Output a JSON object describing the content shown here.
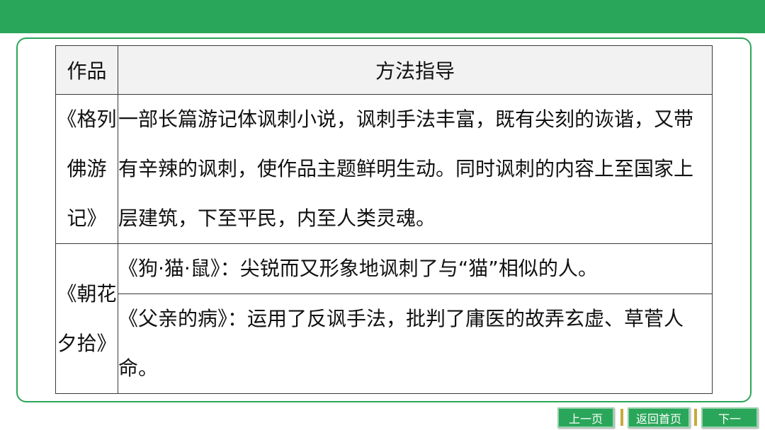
{
  "colors": {
    "accent": "#2aa65a",
    "separator": "#c8a93a"
  },
  "table": {
    "headers": {
      "work": "作品",
      "method": "方法指导"
    },
    "rows": [
      {
        "work": "《格列佛游记》",
        "method": "一部长篇游记体讽刺小说，讽刺手法丰富，既有尖刻的诙谐，又带有辛辣的讽刺，使作品主题鲜明生动。同时讽刺的内容上至国家上层建筑，下至平民，内至人类灵魂。"
      },
      {
        "work": "《朝花夕拾》",
        "methods": [
          "《狗·猫·鼠》：尖锐而又形象地讽刺了与“猫”相似的人。",
          "《父亲的病》：运用了反讽手法，批判了庸医的故弄玄虚、草菅人命。"
        ]
      }
    ]
  },
  "nav": {
    "prev": "上一页",
    "home": "返回首页",
    "next": "下一"
  }
}
